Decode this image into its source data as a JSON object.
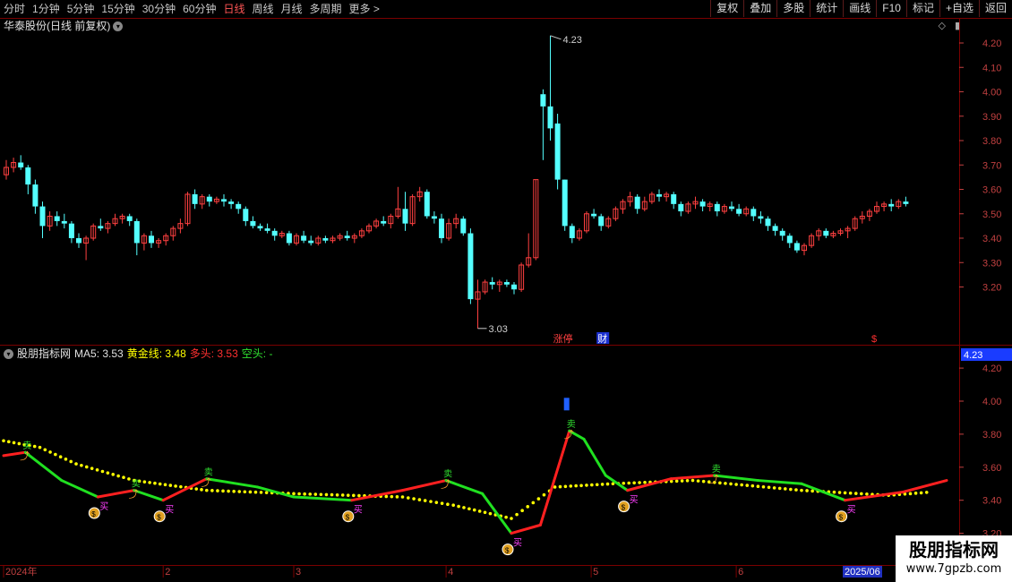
{
  "toolbar": {
    "periods": [
      {
        "label": "分时",
        "active": false
      },
      {
        "label": "1分钟",
        "active": false
      },
      {
        "label": "5分钟",
        "active": false
      },
      {
        "label": "15分钟",
        "active": false
      },
      {
        "label": "30分钟",
        "active": false
      },
      {
        "label": "60分钟",
        "active": false
      },
      {
        "label": "日线",
        "active": true
      },
      {
        "label": "周线",
        "active": false
      },
      {
        "label": "月线",
        "active": false
      },
      {
        "label": "多周期",
        "active": false
      },
      {
        "label": "更多 >",
        "active": false
      }
    ],
    "buttons": [
      "复权",
      "叠加",
      "多股",
      "统计",
      "画线",
      "F10",
      "标记",
      "+自选",
      "返回"
    ]
  },
  "main_chart": {
    "title": "华泰股份(日线 前复权)",
    "y_ticks": [
      "4.20",
      "4.10",
      "4.00",
      "3.90",
      "3.80",
      "3.70",
      "3.60",
      "3.50",
      "3.40",
      "3.30",
      "3.20"
    ],
    "high_label": "4.23",
    "low_label": "3.03",
    "event_tags": [
      "涨停",
      "财"
    ],
    "event_dollar": "$"
  },
  "indicator": {
    "name": "股朋指标网",
    "ma5_label": "MA5: 3.53",
    "gold_label": "黄金线: 3.48",
    "long_label": "多头: 3.53",
    "short_label": "空头: -",
    "y_ticks": [
      "4.20",
      "4.00",
      "3.80",
      "3.60",
      "3.40",
      "3.20"
    ],
    "current_value": "4.23",
    "buy_label": "买",
    "sell_label": "卖"
  },
  "x_axis": {
    "labels": [
      "2024年",
      "2",
      "3",
      "4",
      "5",
      "6"
    ],
    "current_date": "2025/06"
  },
  "watermark": {
    "line1": "股朋指标网",
    "line2": "www.7gpzb.com"
  },
  "colors": {
    "up": "#ff4040",
    "down": "#54ffff",
    "grid": "#7a0000",
    "gold": "#ffff00",
    "long": "#ff2020",
    "short": "#20e020"
  },
  "chart_data": {
    "type": "candlestick",
    "title": "华泰股份(日线 前复权)",
    "ylim": [
      3.03,
      4.23
    ],
    "x_labels": [
      "2024年",
      "2",
      "3",
      "4",
      "5",
      "6",
      "2025/06"
    ],
    "candles": [
      [
        3.66,
        3.72,
        3.64,
        3.69
      ],
      [
        3.69,
        3.73,
        3.67,
        3.71
      ],
      [
        3.71,
        3.74,
        3.68,
        3.69
      ],
      [
        3.69,
        3.7,
        3.58,
        3.62
      ],
      [
        3.62,
        3.64,
        3.5,
        3.53
      ],
      [
        3.53,
        3.55,
        3.4,
        3.45
      ],
      [
        3.45,
        3.51,
        3.43,
        3.49
      ],
      [
        3.49,
        3.51,
        3.45,
        3.47
      ],
      [
        3.47,
        3.5,
        3.44,
        3.46
      ],
      [
        3.46,
        3.47,
        3.38,
        3.4
      ],
      [
        3.4,
        3.42,
        3.36,
        3.38
      ],
      [
        3.38,
        3.41,
        3.31,
        3.4
      ],
      [
        3.4,
        3.46,
        3.39,
        3.45
      ],
      [
        3.45,
        3.48,
        3.43,
        3.44
      ],
      [
        3.44,
        3.47,
        3.42,
        3.46
      ],
      [
        3.46,
        3.5,
        3.45,
        3.48
      ],
      [
        3.48,
        3.5,
        3.46,
        3.49
      ],
      [
        3.49,
        3.5,
        3.45,
        3.47
      ],
      [
        3.47,
        3.48,
        3.33,
        3.38
      ],
      [
        3.38,
        3.42,
        3.35,
        3.41
      ],
      [
        3.41,
        3.43,
        3.36,
        3.38
      ],
      [
        3.38,
        3.4,
        3.36,
        3.39
      ],
      [
        3.39,
        3.42,
        3.37,
        3.41
      ],
      [
        3.41,
        3.45,
        3.39,
        3.44
      ],
      [
        3.44,
        3.48,
        3.42,
        3.46
      ],
      [
        3.46,
        3.59,
        3.45,
        3.58
      ],
      [
        3.58,
        3.6,
        3.52,
        3.54
      ],
      [
        3.54,
        3.58,
        3.52,
        3.57
      ],
      [
        3.57,
        3.58,
        3.53,
        3.55
      ],
      [
        3.55,
        3.57,
        3.54,
        3.56
      ],
      [
        3.56,
        3.58,
        3.53,
        3.55
      ],
      [
        3.55,
        3.56,
        3.52,
        3.54
      ],
      [
        3.54,
        3.55,
        3.5,
        3.52
      ],
      [
        3.52,
        3.53,
        3.45,
        3.47
      ],
      [
        3.47,
        3.49,
        3.44,
        3.45
      ],
      [
        3.45,
        3.46,
        3.43,
        3.44
      ],
      [
        3.44,
        3.46,
        3.42,
        3.43
      ],
      [
        3.43,
        3.44,
        3.39,
        3.41
      ],
      [
        3.41,
        3.43,
        3.4,
        3.42
      ],
      [
        3.42,
        3.43,
        3.37,
        3.38
      ],
      [
        3.38,
        3.42,
        3.37,
        3.41
      ],
      [
        3.41,
        3.43,
        3.38,
        3.39
      ],
      [
        3.39,
        3.41,
        3.37,
        3.38
      ],
      [
        3.38,
        3.41,
        3.37,
        3.4
      ],
      [
        3.4,
        3.41,
        3.38,
        3.39
      ],
      [
        3.39,
        3.41,
        3.38,
        3.4
      ],
      [
        3.4,
        3.42,
        3.39,
        3.41
      ],
      [
        3.41,
        3.43,
        3.39,
        3.4
      ],
      [
        3.4,
        3.42,
        3.38,
        3.41
      ],
      [
        3.41,
        3.44,
        3.4,
        3.43
      ],
      [
        3.43,
        3.46,
        3.42,
        3.45
      ],
      [
        3.45,
        3.48,
        3.44,
        3.47
      ],
      [
        3.47,
        3.49,
        3.45,
        3.46
      ],
      [
        3.46,
        3.5,
        3.44,
        3.49
      ],
      [
        3.49,
        3.61,
        3.48,
        3.52
      ],
      [
        3.52,
        3.59,
        3.43,
        3.46
      ],
      [
        3.46,
        3.58,
        3.45,
        3.57
      ],
      [
        3.57,
        3.61,
        3.55,
        3.59
      ],
      [
        3.59,
        3.6,
        3.48,
        3.49
      ],
      [
        3.49,
        3.51,
        3.46,
        3.48
      ],
      [
        3.48,
        3.5,
        3.38,
        3.4
      ],
      [
        3.4,
        3.48,
        3.39,
        3.46
      ],
      [
        3.46,
        3.5,
        3.44,
        3.48
      ],
      [
        3.48,
        3.49,
        3.41,
        3.42
      ],
      [
        3.42,
        3.44,
        3.13,
        3.15
      ],
      [
        3.15,
        3.23,
        3.03,
        3.18
      ],
      [
        3.18,
        3.23,
        3.17,
        3.22
      ],
      [
        3.22,
        3.24,
        3.19,
        3.21
      ],
      [
        3.21,
        3.23,
        3.18,
        3.22
      ],
      [
        3.22,
        3.23,
        3.2,
        3.21
      ],
      [
        3.21,
        3.22,
        3.17,
        3.19
      ],
      [
        3.19,
        3.3,
        3.18,
        3.29
      ],
      [
        3.29,
        3.42,
        3.28,
        3.32
      ],
      [
        3.32,
        3.64,
        3.31,
        3.64
      ],
      [
        3.99,
        4.01,
        3.72,
        3.94
      ],
      [
        3.94,
        4.23,
        3.8,
        3.85
      ],
      [
        3.87,
        3.91,
        3.6,
        3.64
      ],
      [
        3.64,
        3.64,
        3.43,
        3.45
      ],
      [
        3.45,
        3.46,
        3.38,
        3.4
      ],
      [
        3.4,
        3.44,
        3.39,
        3.43
      ],
      [
        3.43,
        3.51,
        3.42,
        3.5
      ],
      [
        3.5,
        3.52,
        3.48,
        3.49
      ],
      [
        3.49,
        3.5,
        3.43,
        3.45
      ],
      [
        3.45,
        3.49,
        3.44,
        3.48
      ],
      [
        3.48,
        3.53,
        3.47,
        3.52
      ],
      [
        3.52,
        3.56,
        3.5,
        3.55
      ],
      [
        3.55,
        3.59,
        3.53,
        3.57
      ],
      [
        3.57,
        3.58,
        3.5,
        3.52
      ],
      [
        3.52,
        3.57,
        3.51,
        3.55
      ],
      [
        3.55,
        3.59,
        3.54,
        3.58
      ],
      [
        3.58,
        3.6,
        3.55,
        3.57
      ],
      [
        3.57,
        3.59,
        3.55,
        3.58
      ],
      [
        3.58,
        3.59,
        3.52,
        3.54
      ],
      [
        3.54,
        3.55,
        3.49,
        3.51
      ],
      [
        3.51,
        3.55,
        3.5,
        3.54
      ],
      [
        3.54,
        3.57,
        3.52,
        3.55
      ],
      [
        3.55,
        3.56,
        3.51,
        3.53
      ],
      [
        3.53,
        3.55,
        3.51,
        3.54
      ],
      [
        3.54,
        3.55,
        3.49,
        3.51
      ],
      [
        3.51,
        3.54,
        3.5,
        3.53
      ],
      [
        3.53,
        3.55,
        3.51,
        3.52
      ],
      [
        3.52,
        3.54,
        3.49,
        3.5
      ],
      [
        3.5,
        3.53,
        3.49,
        3.52
      ],
      [
        3.52,
        3.53,
        3.47,
        3.49
      ],
      [
        3.49,
        3.51,
        3.46,
        3.48
      ],
      [
        3.48,
        3.49,
        3.43,
        3.45
      ],
      [
        3.45,
        3.46,
        3.41,
        3.43
      ],
      [
        3.43,
        3.44,
        3.39,
        3.41
      ],
      [
        3.41,
        3.42,
        3.36,
        3.38
      ],
      [
        3.38,
        3.39,
        3.34,
        3.35
      ],
      [
        3.35,
        3.38,
        3.33,
        3.37
      ],
      [
        3.37,
        3.42,
        3.36,
        3.41
      ],
      [
        3.41,
        3.44,
        3.39,
        3.43
      ],
      [
        3.43,
        3.44,
        3.4,
        3.41
      ],
      [
        3.41,
        3.43,
        3.4,
        3.42
      ],
      [
        3.42,
        3.44,
        3.41,
        3.43
      ],
      [
        3.43,
        3.45,
        3.4,
        3.44
      ],
      [
        3.44,
        3.49,
        3.43,
        3.48
      ],
      [
        3.48,
        3.51,
        3.46,
        3.49
      ],
      [
        3.49,
        3.52,
        3.47,
        3.51
      ],
      [
        3.51,
        3.55,
        3.5,
        3.53
      ],
      [
        3.53,
        3.55,
        3.51,
        3.54
      ],
      [
        3.54,
        3.56,
        3.51,
        3.53
      ],
      [
        3.53,
        3.56,
        3.52,
        3.55
      ],
      [
        3.55,
        3.57,
        3.53,
        3.54
      ]
    ],
    "indicator_lines": {
      "gold": [
        [
          0,
          3.76
        ],
        [
          5,
          3.72
        ],
        [
          10,
          3.62
        ],
        [
          18,
          3.52
        ],
        [
          28,
          3.46
        ],
        [
          40,
          3.44
        ],
        [
          55,
          3.42
        ],
        [
          62,
          3.37
        ],
        [
          70,
          3.29
        ],
        [
          76,
          3.48
        ],
        [
          84,
          3.5
        ],
        [
          95,
          3.52
        ],
        [
          110,
          3.46
        ],
        [
          122,
          3.43
        ],
        [
          128,
          3.45
        ]
      ],
      "ma5": [
        [
          0,
          3.67
        ],
        [
          3,
          3.69
        ],
        [
          8,
          3.52
        ],
        [
          13,
          3.42
        ],
        [
          18,
          3.46
        ],
        [
          22,
          3.4
        ],
        [
          28,
          3.53
        ],
        [
          35,
          3.48
        ],
        [
          40,
          3.42
        ],
        [
          48,
          3.4
        ],
        [
          55,
          3.46
        ],
        [
          61,
          3.52
        ],
        [
          66,
          3.44
        ],
        [
          70,
          3.2
        ],
        [
          74,
          3.25
        ],
        [
          78,
          3.82
        ],
        [
          80,
          3.77
        ],
        [
          83,
          3.55
        ],
        [
          86,
          3.46
        ],
        [
          92,
          3.53
        ],
        [
          98,
          3.55
        ],
        [
          104,
          3.52
        ],
        [
          110,
          3.5
        ],
        [
          116,
          3.4
        ],
        [
          124,
          3.45
        ],
        [
          130,
          3.52
        ]
      ]
    },
    "event_markers": [
      {
        "x": 76,
        "label": "涨停"
      },
      {
        "x": 82,
        "label": "财"
      },
      {
        "x": 120,
        "label": "$"
      }
    ]
  }
}
